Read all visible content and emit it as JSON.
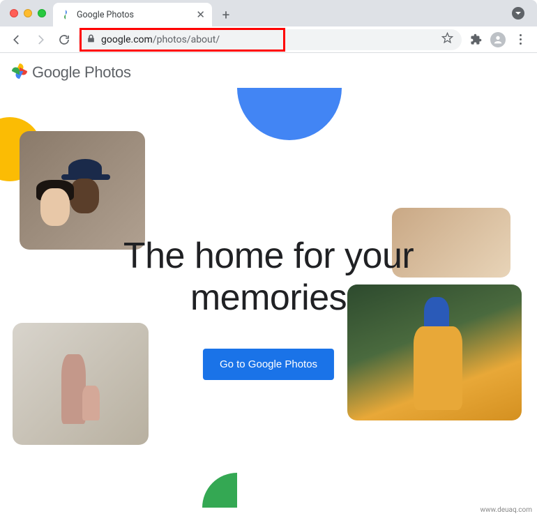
{
  "browser": {
    "tab_title": "Google Photos",
    "url_domain": "google.com",
    "url_path": "/photos/about/",
    "icons": {
      "back": "back-arrow-icon",
      "forward": "forward-arrow-icon",
      "reload": "reload-icon",
      "lock": "lock-icon",
      "star": "star-icon",
      "extensions": "puzzle-icon",
      "profile": "profile-icon",
      "menu": "kebab-menu-icon",
      "new_tab": "plus-icon",
      "close_tab": "close-icon",
      "chevron": "chevron-down-icon"
    }
  },
  "page": {
    "logo_text": "Google Photos",
    "hero_line1": "The home for your",
    "hero_line2": "memories",
    "cta_label": "Go to Google Photos"
  },
  "watermark": "www.deuaq.com"
}
